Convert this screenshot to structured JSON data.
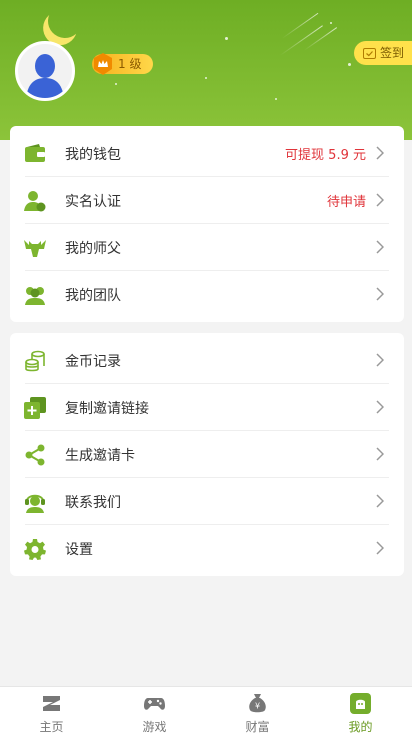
{
  "header": {
    "level_label": "1 级",
    "signin_label": "签到"
  },
  "colors": {
    "brand_green": "#7db52f",
    "accent_red": "#e0343a",
    "badge_gold": "#f6b01c"
  },
  "card_account": {
    "items": [
      {
        "label": "我的钱包",
        "value": "可提现 5.9 元",
        "icon": "wallet-icon"
      },
      {
        "label": "实名认证",
        "value": "待申请",
        "icon": "user-verify-icon"
      },
      {
        "label": "我的师父",
        "value": "",
        "icon": "master-icon"
      },
      {
        "label": "我的团队",
        "value": "",
        "icon": "team-icon"
      }
    ]
  },
  "card_tools": {
    "items": [
      {
        "label": "金币记录",
        "icon": "coins-icon"
      },
      {
        "label": "复制邀请链接",
        "icon": "copy-link-icon"
      },
      {
        "label": "生成邀请卡",
        "icon": "share-icon"
      },
      {
        "label": "联系我们",
        "icon": "support-icon"
      },
      {
        "label": "设置",
        "icon": "gear-icon"
      }
    ]
  },
  "tabbar": {
    "tabs": [
      {
        "label": "主页",
        "icon": "home-icon",
        "active": false
      },
      {
        "label": "游戏",
        "icon": "gamepad-icon",
        "active": false
      },
      {
        "label": "财富",
        "icon": "money-bag-icon",
        "active": false
      },
      {
        "label": "我的",
        "icon": "profile-icon",
        "active": true
      }
    ]
  }
}
